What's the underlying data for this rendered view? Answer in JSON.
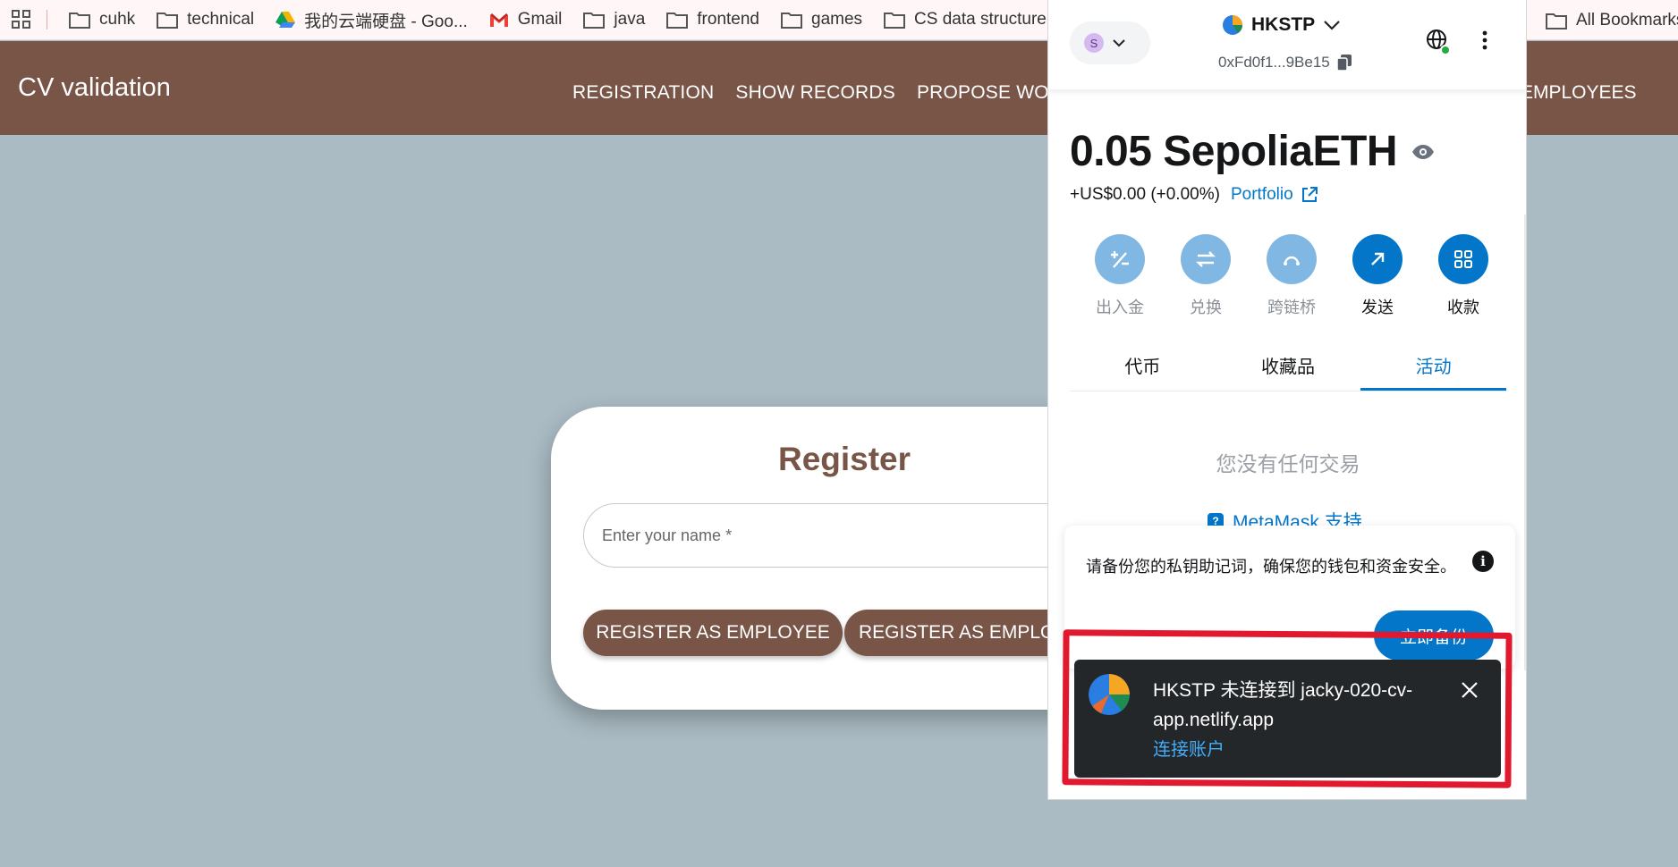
{
  "bookmarks": {
    "items": [
      {
        "label": "cuhk",
        "icon": "folder-icon"
      },
      {
        "label": "technical",
        "icon": "folder-icon"
      },
      {
        "label": "我的云端硬盘 - Goo...",
        "icon": "google-drive-icon"
      },
      {
        "label": "Gmail",
        "icon": "gmail-icon"
      },
      {
        "label": "java",
        "icon": "folder-icon"
      },
      {
        "label": "frontend",
        "icon": "folder-icon"
      },
      {
        "label": "games",
        "icon": "folder-icon"
      },
      {
        "label": "CS data structure",
        "icon": "folder-icon"
      }
    ],
    "all_bookmarks": "All Bookmarks"
  },
  "app": {
    "title": "CV validation",
    "nav": [
      "REGISTRATION",
      "SHOW RECORDS",
      "PROPOSE WOR"
    ],
    "nav_right": "EMPLOYEES"
  },
  "register": {
    "title": "Register",
    "name_placeholder": "Enter your name *",
    "btn_employee": "REGISTER AS EMPLOYEE",
    "btn_employer": "REGISTER AS EMPLO"
  },
  "metamask": {
    "network_badge": "S",
    "account_name": "HKSTP",
    "address": "0xFd0f1...9Be15",
    "balance": "0.05 SepoliaETH",
    "fiat_change": "+US$0.00 (+0.00%)",
    "portfolio_label": "Portfolio",
    "actions": [
      {
        "label": "出入金",
        "icon": "buy-sell-icon",
        "enabled": false
      },
      {
        "label": "兑换",
        "icon": "swap-icon",
        "enabled": false
      },
      {
        "label": "跨链桥",
        "icon": "bridge-icon",
        "enabled": false
      },
      {
        "label": "发送",
        "icon": "send-arrow-icon",
        "enabled": true
      },
      {
        "label": "收款",
        "icon": "receive-qr-icon",
        "enabled": true
      }
    ],
    "tabs": [
      "代币",
      "收藏品",
      "活动"
    ],
    "active_tab": "活动",
    "empty_text": "您没有任何交易",
    "support_label": "MetaMask 支持",
    "backup_text": "请备份您的私钥助记词，确保您的钱包和资金安全。",
    "backup_button": "立即备份",
    "accent_color": "#0376c9"
  },
  "toast": {
    "message": "HKSTP 未连接到 jacky-020-cv-app.netlify.app",
    "link": "连接账户"
  }
}
